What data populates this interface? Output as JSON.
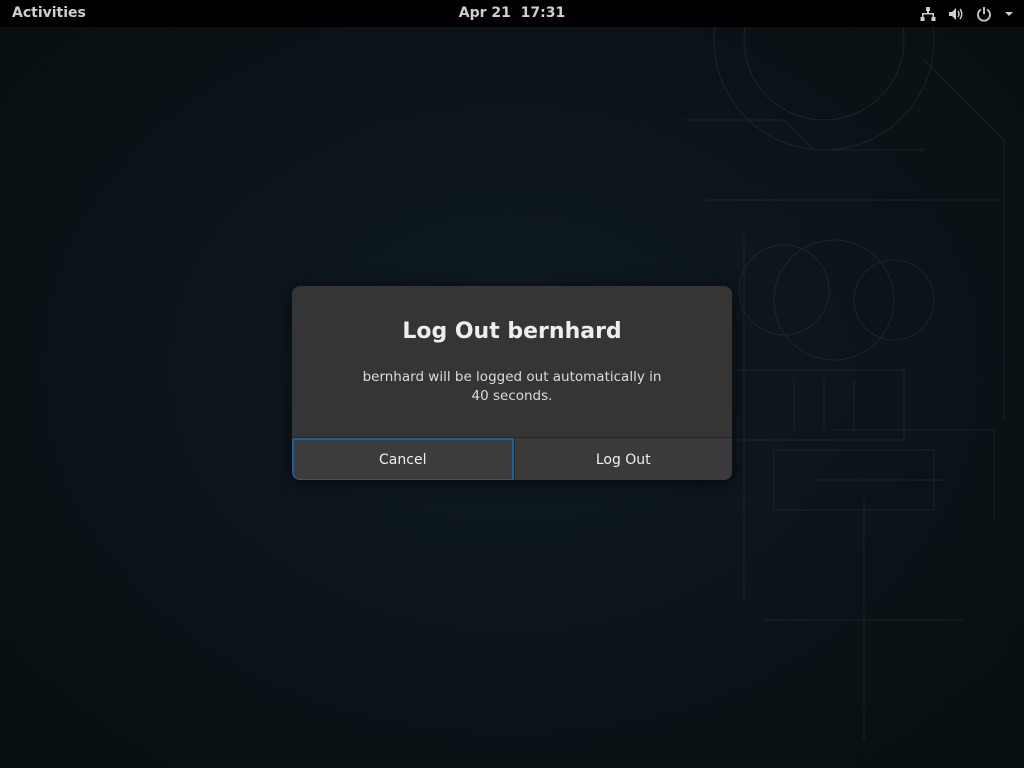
{
  "topbar": {
    "activities_label": "Activities",
    "clock": "Apr 21  17:31",
    "tray_icons": [
      "network-icon",
      "volume-icon",
      "power-icon",
      "dropdown-arrow-icon"
    ]
  },
  "dialog": {
    "title": "Log Out bernhard",
    "message": "bernhard will be logged out automatically in 40 seconds.",
    "countdown_seconds": 40,
    "cancel_label": "Cancel",
    "logout_label": "Log Out",
    "focused_button": "Cancel"
  },
  "colors": {
    "dialog_bg": "#353535",
    "focus_ring": "#1f5d96",
    "topbar_bg": "#000000"
  }
}
